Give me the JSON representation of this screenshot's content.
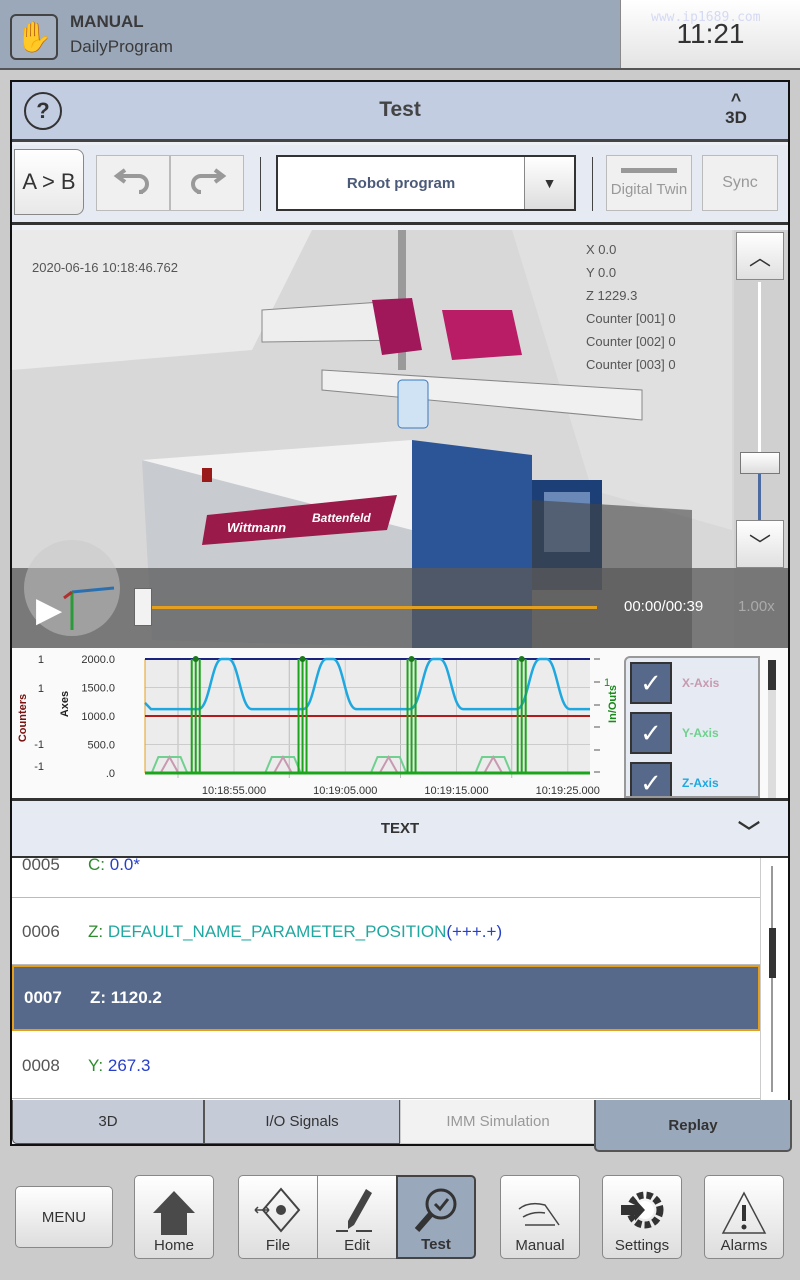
{
  "status": {
    "mode": "MANUAL",
    "program": "DailyProgram",
    "time": "11:21",
    "watermark": "www.ip1689.com",
    "mode_icon": "hand-icon"
  },
  "header": {
    "title": "Test",
    "help_icon": "question-icon",
    "toggle_label": "3D",
    "toggle_icon": "chevron-up-icon"
  },
  "toolbar": {
    "compare_label": "A > B",
    "undo_icon": "undo-icon",
    "redo_icon": "redo-icon",
    "program_select": "Robot program",
    "digital_twin": "Digital Twin",
    "sync": "Sync"
  },
  "view": {
    "timestamp": "2020-06-16 10:18:46.762",
    "readouts": [
      "X 0.0",
      "Y 0.0",
      "Z 1229.3",
      "Counter [001] 0",
      "Counter [002] 0",
      "Counter [003] 0"
    ],
    "brand": [
      "Wittmann",
      "Battenfeld"
    ],
    "playback": {
      "time": "00:00/00:39",
      "speed": "1.00x",
      "progress": 0
    },
    "zoom_level": 0.45
  },
  "chart_data": {
    "type": "line",
    "y_axis_label": "Axes",
    "counters_label": "Counters",
    "io_label": "In/Outs",
    "y_ticks": [
      "2000.0",
      "1500.0",
      "1000.0",
      "500.0",
      ".0"
    ],
    "counter_ticks": [
      "1",
      "1",
      "-1",
      "-1"
    ],
    "io_ticks": [
      "1"
    ],
    "ylim": [
      0,
      2000
    ],
    "xlim": [
      "10:18:47",
      "10:19:27"
    ],
    "x_ticks": [
      "10:18:55.000",
      "10:19:05.000",
      "10:19:15.000",
      "10:19:25.000"
    ],
    "grid": true,
    "colors": {
      "x": "#c79ab0",
      "y": "#6fd08f",
      "z": "#1fa8e0",
      "io": "#1aa51a",
      "ref_top": "#1a237e",
      "ref_mid": "#b01c1c"
    },
    "reference_lines": [
      2000,
      1000
    ],
    "z_peaks": [
      "10:18:54.2",
      "10:19:03.6",
      "10:19:13.2",
      "10:19:22.8"
    ],
    "z_low": 1120,
    "z_high": 2000,
    "io_pulses": [
      "10:18:51.2",
      "10:19:00.8",
      "10:19:10.6",
      "10:19:20.5"
    ],
    "y_bumps": [
      "10:18:49.2",
      "10:18:59.4",
      "10:19:08.9",
      "10:19:18.3"
    ],
    "y_bump_value": 280,
    "legend": [
      {
        "label": "X-Axis",
        "checked": true
      },
      {
        "label": "Y-Axis",
        "checked": true
      },
      {
        "label": "Z-Axis",
        "checked": true
      }
    ]
  },
  "text_panel": {
    "title": "TEXT",
    "rows": [
      {
        "num": "0005",
        "key": "C:",
        "val": "0.0*"
      },
      {
        "num": "0006",
        "key": "Z:",
        "val": "DEFAULT_NAME_PARAMETER_POSITION",
        "suffix": "(+++.+)"
      },
      {
        "num": "0007",
        "key": "Z:",
        "val": "1120.2",
        "selected": true
      },
      {
        "num": "0008",
        "key": "Y:",
        "val": "267.3"
      }
    ]
  },
  "tabs": [
    {
      "label": "3D"
    },
    {
      "label": "I/O Signals"
    },
    {
      "label": "IMM Simulation",
      "disabled": true
    },
    {
      "label": "Replay",
      "active": true
    }
  ],
  "nav": {
    "menu": "MENU",
    "home": "Home",
    "file": "File",
    "edit": "Edit",
    "test": "Test",
    "manual": "Manual",
    "settings": "Settings",
    "alarms": "Alarms"
  }
}
